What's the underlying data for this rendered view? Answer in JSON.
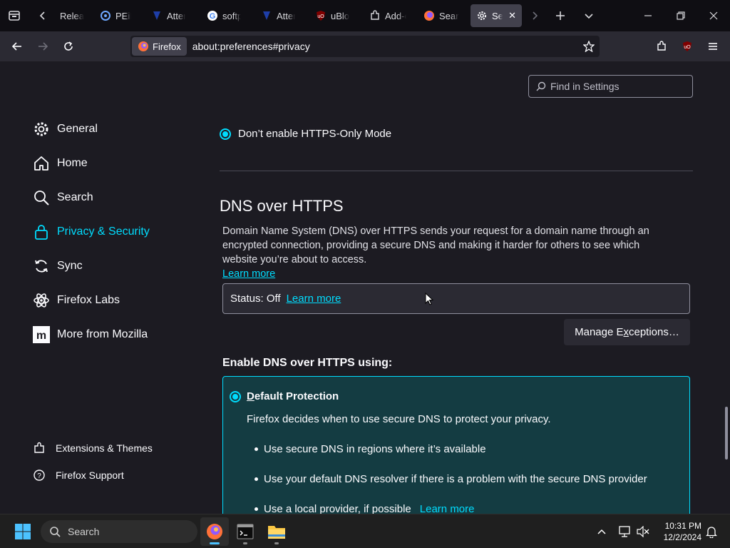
{
  "tabs": [
    {
      "label": "Relea",
      "icon": "generic-page-icon"
    },
    {
      "label": "PEiD -",
      "icon": "peid-icon"
    },
    {
      "label": "Attem",
      "icon": "site-shield-icon"
    },
    {
      "label": "softpe",
      "icon": "google-icon"
    },
    {
      "label": "Attem",
      "icon": "site-shield-icon"
    },
    {
      "label": "uBloc",
      "icon": "ublock-icon"
    },
    {
      "label": "Add-o",
      "icon": "puzzle-icon"
    },
    {
      "label": "Searc",
      "icon": "firefox-icon"
    },
    {
      "label": "Setti",
      "icon": "gear-icon",
      "active": true
    }
  ],
  "navbar": {
    "identity_label": "Firefox",
    "url": "about:preferences#privacy"
  },
  "search": {
    "placeholder": "Find in Settings"
  },
  "sidebar": {
    "items": [
      {
        "label": "General",
        "icon": "gear-icon"
      },
      {
        "label": "Home",
        "icon": "home-icon"
      },
      {
        "label": "Search",
        "icon": "search-icon"
      },
      {
        "label": "Privacy & Security",
        "icon": "lock-icon",
        "selected": true
      },
      {
        "label": "Sync",
        "icon": "sync-icon"
      },
      {
        "label": "Firefox Labs",
        "icon": "labs-icon"
      },
      {
        "label": "More from Mozilla",
        "icon": "mozilla-icon"
      }
    ],
    "footer": [
      {
        "label": "Extensions & Themes",
        "icon": "puzzle-icon"
      },
      {
        "label": "Firefox Support",
        "icon": "help-icon"
      }
    ]
  },
  "https_only": {
    "option_label": "Don’t enable HTTPS-Only Mode"
  },
  "dns": {
    "heading": "DNS over HTTPS",
    "description_line1": "Domain Name System (DNS) over HTTPS sends your request for a domain name through an",
    "description_line2": "encrypted connection, providing a secure DNS and making it harder for others to see which",
    "description_line3": "website you’re about to access.",
    "learn_more": "Learn more",
    "status_text": "Status: Off",
    "status_learn_more": "Learn more",
    "manage_prefix": "Manage E",
    "manage_access_key": "x",
    "manage_suffix": "ceptions…",
    "enable_heading": "Enable DNS over HTTPS using:",
    "default": {
      "access_key": "D",
      "title_rest": "efault Protection",
      "description": "Firefox decides when to use secure DNS to protect your privacy.",
      "bullets": [
        "Use secure DNS in regions where it’s available",
        "Use your default DNS resolver if there is a problem with the secure DNS provider",
        "Use a local provider, if possible"
      ],
      "bullet_learn_more": "Learn more"
    }
  },
  "taskbar": {
    "search_label": "Search",
    "time": "10:31 PM",
    "date": "12/2/2024"
  },
  "colors": {
    "accent": "#00ddff",
    "background": "#1c1b22",
    "toolbar": "#2b2a33",
    "card": "#143c42"
  }
}
